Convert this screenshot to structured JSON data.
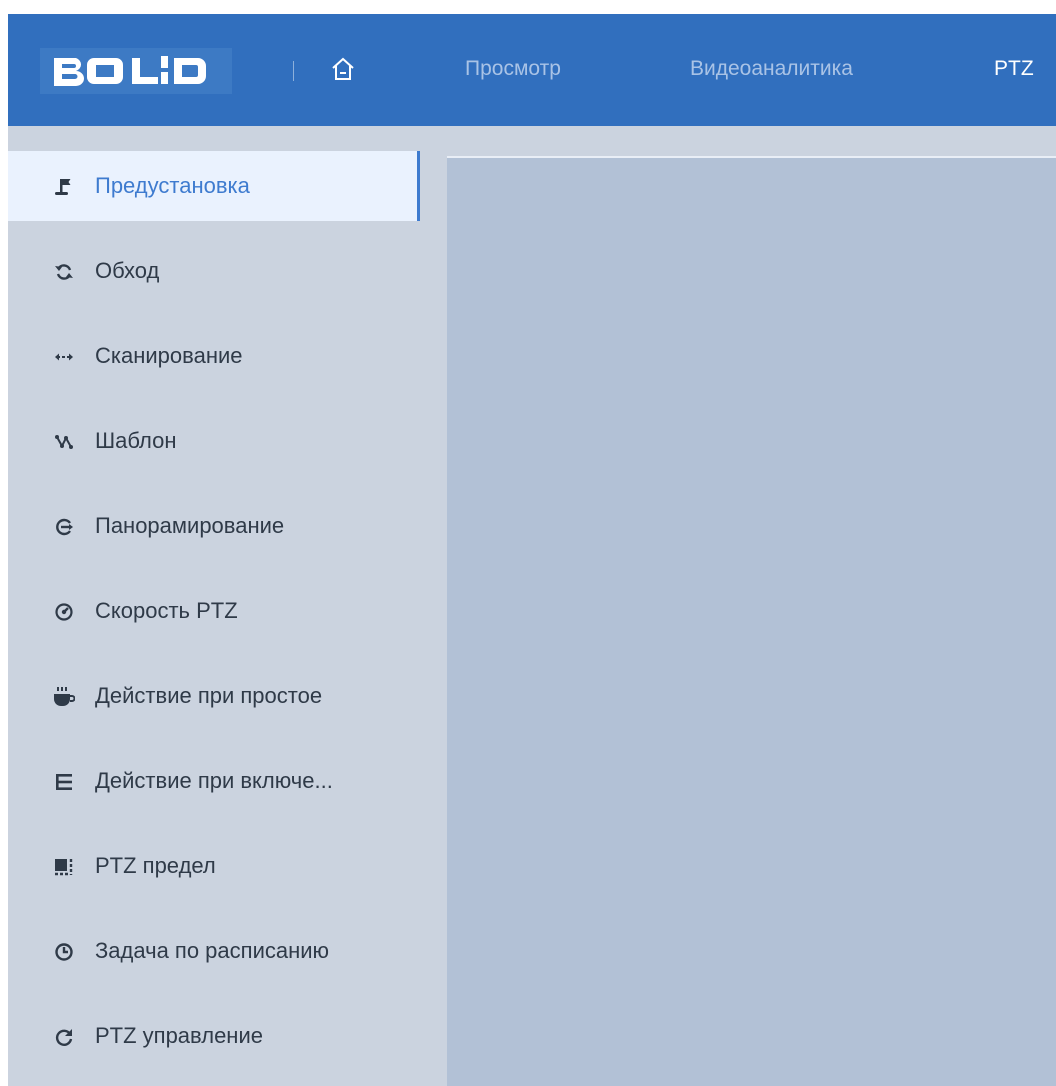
{
  "header": {
    "logo_text": "BOLID",
    "nav": [
      {
        "label": "Просмотр",
        "active": false
      },
      {
        "label": "Видеоаналитика",
        "active": false
      },
      {
        "label": "PTZ",
        "active": true
      }
    ]
  },
  "sidebar": {
    "items": [
      {
        "label": "Предустановка",
        "icon": "preset-flag-icon",
        "active": true
      },
      {
        "label": "Обход",
        "icon": "tour-icon",
        "active": false
      },
      {
        "label": "Сканирование",
        "icon": "scan-icon",
        "active": false
      },
      {
        "label": "Шаблон",
        "icon": "pattern-icon",
        "active": false
      },
      {
        "label": "Панорамирование",
        "icon": "pan-icon",
        "active": false
      },
      {
        "label": "Скорость PTZ",
        "icon": "speed-icon",
        "active": false
      },
      {
        "label": "Действие при простое",
        "icon": "idle-cup-icon",
        "active": false
      },
      {
        "label": "Действие при включе...",
        "icon": "power-up-list-icon",
        "active": false
      },
      {
        "label": "PTZ предел",
        "icon": "limit-icon",
        "active": false
      },
      {
        "label": "Задача по расписанию",
        "icon": "clock-icon",
        "active": false
      },
      {
        "label": "PTZ управление",
        "icon": "refresh-icon",
        "active": false
      }
    ]
  },
  "colors": {
    "header_bg": "#316fbe",
    "accent": "#3e7bcf",
    "sidebar_bg": "#cbd3df",
    "panel_bg": "#b2c1d6"
  }
}
